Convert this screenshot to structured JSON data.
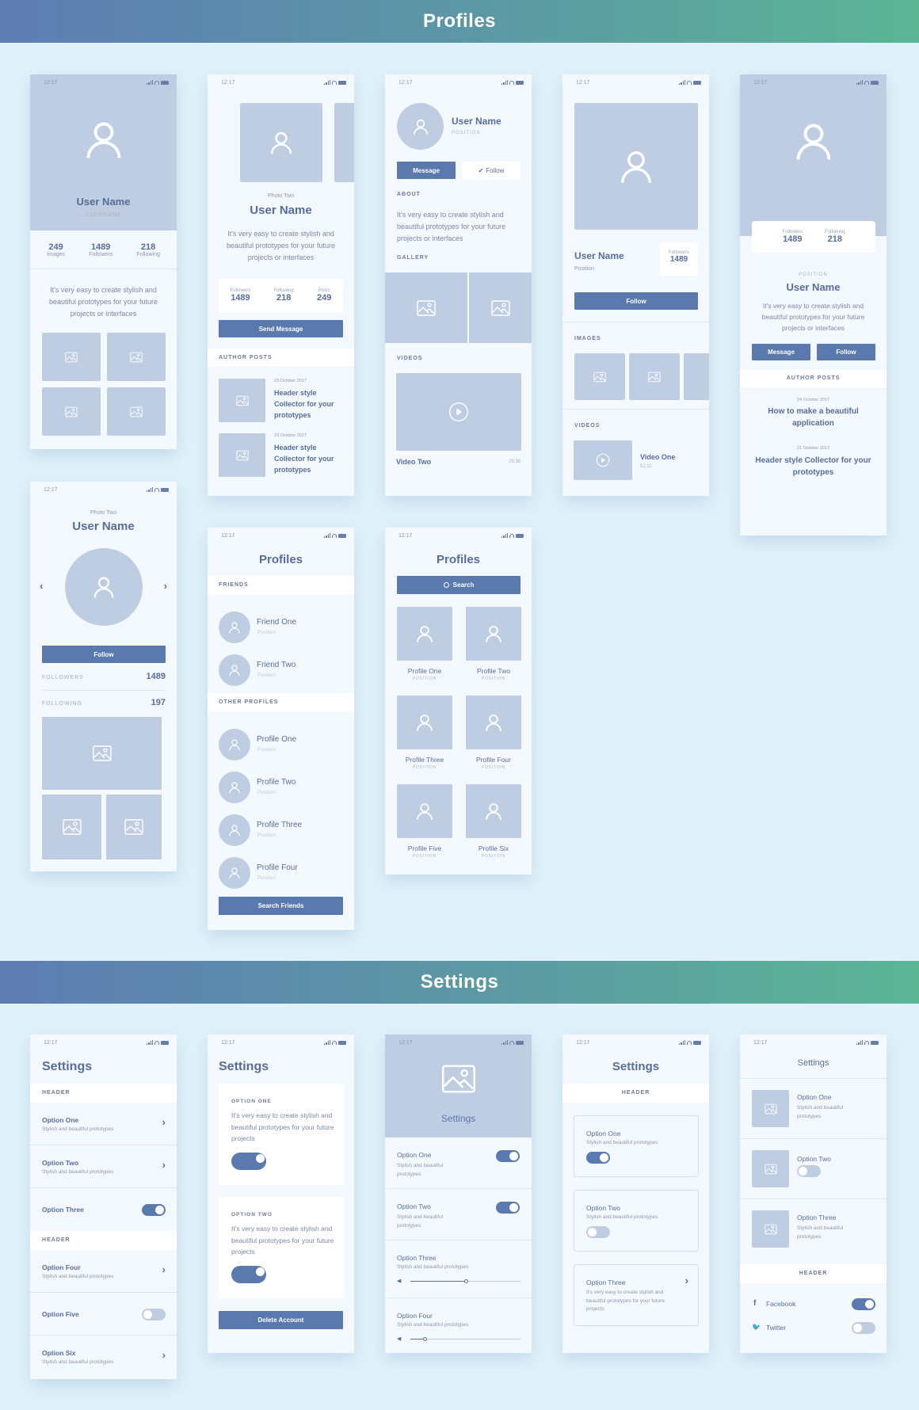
{
  "banners": {
    "profiles": "Profiles",
    "settings": "Settings"
  },
  "status": {
    "time": "12:17"
  },
  "colors": {
    "accent": "#5a79ae",
    "placeholder": "#bfcde2",
    "background": "#e1f1fa",
    "gradient_start": "#5e7db3",
    "gradient_end": "#5bb595"
  },
  "p1": {
    "name": "User Name",
    "username": "USERNAME",
    "stats": [
      {
        "value": "249",
        "label": "Images"
      },
      {
        "value": "1489",
        "label": "Followers"
      },
      {
        "value": "218",
        "label": "Following"
      }
    ],
    "bio": "It's very easy to create stylish and beautiful prototypes for your future projects or interfaces"
  },
  "p2": {
    "caption": "Photo Two",
    "name": "User Name",
    "bio": "It's very easy to create stylish and beautiful prototypes for your future projects or interfaces",
    "stats": [
      {
        "label": "Followers",
        "value": "1489"
      },
      {
        "label": "Following",
        "value": "218"
      },
      {
        "label": "Posts",
        "value": "249"
      }
    ],
    "button": "Send Message",
    "section": "AUTHOR POSTS",
    "posts": [
      {
        "date": "23 October 2017",
        "title": "Header style Collector for your prototypes"
      },
      {
        "date": "23 October 2017",
        "title": "Header style Collector for your prototypes"
      }
    ]
  },
  "p3": {
    "name": "User Name",
    "position": "POSITION",
    "message": "Message",
    "follow": "Follow",
    "about": "ABOUT",
    "bio": "It's very easy to create stylish and beautiful prototypes for your future projects or interfaces",
    "gallery": "GALLERY",
    "videos": "VIDEOS",
    "video_title": "Video Two",
    "video_time": "29:36"
  },
  "p4": {
    "name": "User Name",
    "position": "Position",
    "followers_label": "Followers",
    "followers": "1489",
    "follow": "Follow",
    "images": "IMAGES",
    "videos": "VIDEOS",
    "video_title": "Video One",
    "video_time": "52:11"
  },
  "p5": {
    "stats": [
      {
        "label": "Followers",
        "value": "1489"
      },
      {
        "label": "Following",
        "value": "218"
      }
    ],
    "position": "POSITION",
    "name": "User Name",
    "bio": "It's very easy to create stylish and beautiful prototypes for your future projects or interfaces",
    "message": "Message",
    "follow": "Follow",
    "section": "AUTHOR POSTS",
    "posts": [
      {
        "date": "24 October 2017",
        "title": "How to make a beautiful application"
      },
      {
        "date": "21 October 2017",
        "title": "Header style Collector for your prototypes"
      }
    ]
  },
  "p6": {
    "caption": "Photo Two",
    "name": "User Name",
    "follow": "Follow",
    "followers_label": "FOLLOWERS",
    "followers": "1489",
    "following_label": "FOLLOWING",
    "following": "197"
  },
  "p7": {
    "title": "Profiles",
    "friends": "FRIENDS",
    "friend_list": [
      {
        "name": "Friend One",
        "sub": "Position"
      },
      {
        "name": "Friend Two",
        "sub": "Position"
      }
    ],
    "other": "OTHER PROFILES",
    "other_list": [
      {
        "name": "Profile One",
        "sub": "Position"
      },
      {
        "name": "Profile Two",
        "sub": "Position"
      },
      {
        "name": "Profile Three",
        "sub": "Position"
      },
      {
        "name": "Profile Four",
        "sub": "Position"
      }
    ],
    "button": "Search Friends"
  },
  "p8": {
    "title": "Profiles",
    "search": "Search",
    "grid": [
      {
        "name": "Profile One",
        "sub": "POSITION"
      },
      {
        "name": "Profile Two",
        "sub": "POSITION"
      },
      {
        "name": "Profile Three",
        "sub": "POSITION"
      },
      {
        "name": "Profile Four",
        "sub": "POSITION"
      },
      {
        "name": "Profile Five",
        "sub": "POSITION"
      },
      {
        "name": "Profile Six",
        "sub": "POSITION"
      }
    ]
  },
  "s1": {
    "title": "Settings",
    "header1": "HEADER",
    "header2": "HEADER",
    "items": [
      {
        "title": "Option One",
        "sub": "Stylish and beautiful prototypes"
      },
      {
        "title": "Option Two",
        "sub": "Stylish and beautiful prototypes"
      },
      {
        "title": "Option Three",
        "toggle": true
      },
      {
        "title": "Option Four",
        "sub": "Stylish and beautiful prototypes"
      },
      {
        "title": "Option Five",
        "toggle": false
      },
      {
        "title": "Option Six",
        "sub": "Stylish and beautiful prototypes"
      }
    ]
  },
  "s2": {
    "title": "Settings",
    "cards": [
      {
        "label": "OPTION ONE",
        "text": "It's very easy to create stylish and beautiful prototypes for your future projects",
        "toggle": true
      },
      {
        "label": "OPTION TWO",
        "text": "It's very easy to create stylish and beautiful prototypes for your future projects",
        "toggle": true
      }
    ],
    "button": "Delete Account"
  },
  "s3": {
    "title": "Settings",
    "items": [
      {
        "title": "Option One",
        "sub": "Stylish and beautiful prototypes",
        "toggle": true
      },
      {
        "title": "Option Two",
        "sub": "Stylish and beautiful prototypes",
        "toggle": true
      },
      {
        "title": "Option Three",
        "sub": "Stylish and beautiful prototypes",
        "slider": 0.5
      },
      {
        "title": "Option Four",
        "sub": "Stylish and beautiful prototypes",
        "slider": 0.13
      }
    ]
  },
  "s4": {
    "title": "Settings",
    "header": "HEADER",
    "cards": [
      {
        "title": "Option One",
        "sub": "Stylish and beautiful prototypes",
        "toggle": true
      },
      {
        "title": "Option Two",
        "sub": "Stylish and beautiful prototypes",
        "toggle": false
      },
      {
        "title": "Option Three",
        "sub": "It's very easy to create stylish and beautiful prototypes for your future projects"
      }
    ]
  },
  "s5": {
    "title": "Settings",
    "items": [
      {
        "title": "Option One",
        "sub": "Stylish and beautiful prototypes"
      },
      {
        "title": "Option Two",
        "toggle": false
      },
      {
        "title": "Option Three",
        "sub": "Stylish and beautiful prototypes"
      }
    ],
    "header": "HEADER",
    "social": [
      {
        "name": "Facebook",
        "icon": "facebook-icon",
        "toggle": true
      },
      {
        "name": "Twitter",
        "icon": "twitter-icon",
        "toggle": false
      }
    ]
  }
}
